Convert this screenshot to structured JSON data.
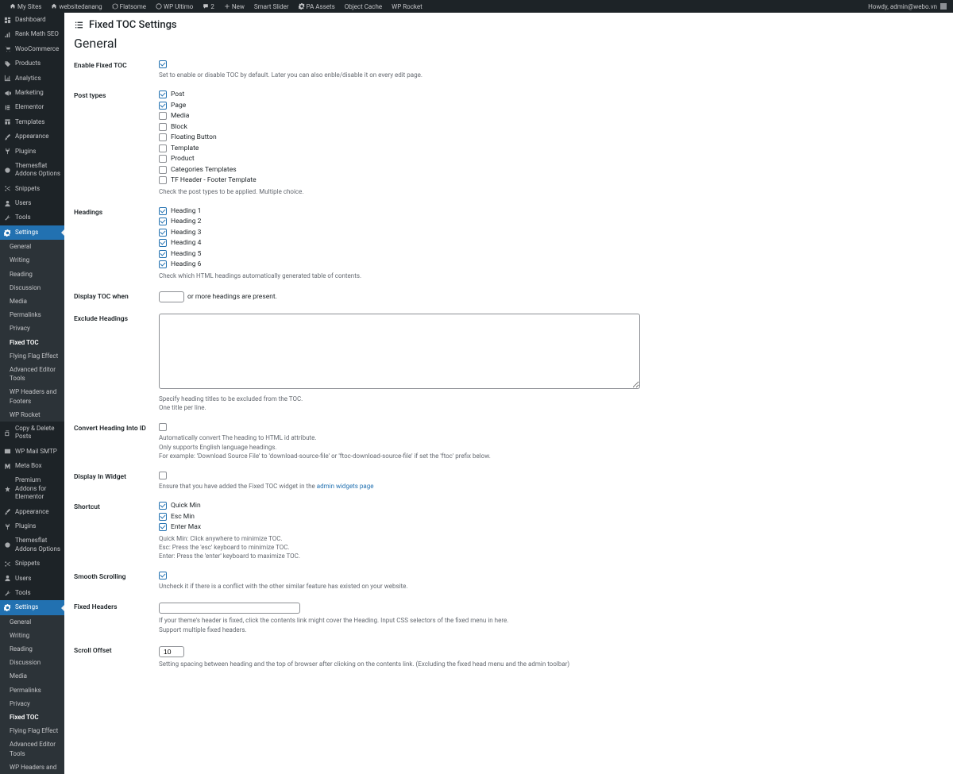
{
  "topbar": {
    "left": [
      {
        "icon": "home",
        "label": "My Sites"
      },
      {
        "icon": "home",
        "label": "websitedanang"
      },
      {
        "icon": "refresh",
        "label": "Flatsome"
      },
      {
        "icon": "wp",
        "label": "WP Ultimo"
      },
      {
        "icon": "comment",
        "label": "2"
      },
      {
        "icon": "plus",
        "label": "New"
      },
      {
        "icon": "",
        "label": "Smart Slider"
      },
      {
        "icon": "gear",
        "label": "PA Assets"
      },
      {
        "icon": "",
        "label": "Object Cache"
      },
      {
        "icon": "",
        "label": "WP Rocket"
      }
    ],
    "howdy": "Howdy, admin@webo.vn"
  },
  "sidebar": {
    "top": [
      {
        "icon": "dashboard",
        "label": "Dashboard"
      },
      {
        "icon": "rank",
        "label": "Rank Math SEO"
      },
      {
        "icon": "cart",
        "label": "WooCommerce"
      },
      {
        "icon": "tag",
        "label": "Products"
      },
      {
        "icon": "chart",
        "label": "Analytics"
      },
      {
        "icon": "megaphone",
        "label": "Marketing"
      },
      {
        "icon": "elementor",
        "label": "Elementor"
      },
      {
        "icon": "templates",
        "label": "Templates"
      },
      {
        "icon": "brush",
        "label": "Appearance"
      },
      {
        "icon": "plug",
        "label": "Plugins"
      },
      {
        "icon": "themesflat",
        "label": "Themesflat Addons Options"
      },
      {
        "icon": "scissors",
        "label": "Snippets"
      },
      {
        "icon": "user",
        "label": "Users"
      },
      {
        "icon": "wrench",
        "label": "Tools"
      }
    ],
    "settings_label": "Settings",
    "settings_sub": [
      {
        "label": "General"
      },
      {
        "label": "Writing"
      },
      {
        "label": "Reading"
      },
      {
        "label": "Discussion"
      },
      {
        "label": "Media"
      },
      {
        "label": "Permalinks"
      },
      {
        "label": "Privacy"
      },
      {
        "label": "Fixed TOC",
        "active": true
      },
      {
        "label": "Flying Flag Effect"
      },
      {
        "label": "Advanced Editor Tools"
      },
      {
        "label": "WP Headers and Footers"
      },
      {
        "label": "WP Rocket"
      }
    ],
    "bottom": [
      {
        "icon": "copy",
        "label": "Copy & Delete Posts"
      },
      {
        "icon": "mail",
        "label": "WP Mail SMTP"
      },
      {
        "icon": "m",
        "label": "Meta Box"
      },
      {
        "icon": "premium",
        "label": "Premium Addons for Elementor"
      },
      {
        "icon": "brush",
        "label": "Appearance"
      },
      {
        "icon": "plug",
        "label": "Plugins"
      },
      {
        "icon": "themesflat",
        "label": "Themesflat Addons Options"
      },
      {
        "icon": "scissors",
        "label": "Snippets"
      },
      {
        "icon": "user",
        "label": "Users"
      },
      {
        "icon": "wrench",
        "label": "Tools"
      }
    ],
    "settings2_label": "Settings",
    "settings2_sub": [
      {
        "label": "General"
      },
      {
        "label": "Writing"
      },
      {
        "label": "Reading"
      },
      {
        "label": "Discussion"
      },
      {
        "label": "Media"
      },
      {
        "label": "Permalinks"
      },
      {
        "label": "Privacy"
      },
      {
        "label": "Fixed TOC",
        "active": true
      },
      {
        "label": "Flying Flag Effect"
      },
      {
        "label": "Advanced Editor Tools"
      },
      {
        "label": "WP Headers and"
      }
    ]
  },
  "main": {
    "page_title": "Fixed TOC Settings",
    "section": "General",
    "enable_label": "Enable Fixed TOC",
    "enable_desc": "Set to enable or disable TOC by default. Later you can also enble/disable it on every edit page.",
    "posttypes_label": "Post types",
    "posttypes": [
      {
        "label": "Post",
        "checked": true
      },
      {
        "label": "Page",
        "checked": true
      },
      {
        "label": "Media",
        "checked": false
      },
      {
        "label": "Block",
        "checked": false
      },
      {
        "label": "Floating Button",
        "checked": false
      },
      {
        "label": "Template",
        "checked": false
      },
      {
        "label": "Product",
        "checked": false
      },
      {
        "label": "Categories Templates",
        "checked": false
      },
      {
        "label": "TF Header - Footer Template",
        "checked": false
      }
    ],
    "posttypes_desc": "Check the post types to be applied. Multiple choice.",
    "headings_label": "Headings",
    "headings": [
      {
        "label": "Heading 1",
        "checked": true
      },
      {
        "label": "Heading 2",
        "checked": true
      },
      {
        "label": "Heading 3",
        "checked": true
      },
      {
        "label": "Heading 4",
        "checked": true
      },
      {
        "label": "Heading 5",
        "checked": true
      },
      {
        "label": "Heading 6",
        "checked": true
      }
    ],
    "headings_desc": "Check which HTML headings automatically generated table of contents.",
    "display_when_label": "Display TOC when",
    "display_when_suffix": "or more headings are present.",
    "exclude_label": "Exclude Headings",
    "exclude_desc1": "Specify heading titles to be excluded from the TOC.",
    "exclude_desc2": "One title per line.",
    "convert_label": "Convert Heading Into ID",
    "convert_desc1": "Automatically convert The heading to HTML id attribute.",
    "convert_desc2": "Only supports English language headings.",
    "convert_desc3": "For example: 'Download Source File' to 'download-source-file' or 'ftoc-download-source-file' if set the 'ftoc' prefix below.",
    "widget_label": "Display In Widget",
    "widget_desc": "Ensure that you have added the Fixed TOC widget in the ",
    "widget_link": "admin widgets page",
    "shortcut_label": "Shortcut",
    "shortcuts": [
      {
        "label": "Quick Min",
        "checked": true
      },
      {
        "label": "Esc Min",
        "checked": true
      },
      {
        "label": "Enter Max",
        "checked": true
      }
    ],
    "shortcut_desc1": "Quick Min: Click anywhere to minimize TOC.",
    "shortcut_desc2": "Esc: Press the 'esc' keyboard to minimize TOC.",
    "shortcut_desc3": "Enter: Press the 'enter' keyboard to maximize TOC.",
    "smooth_label": "Smooth Scrolling",
    "smooth_desc": "Uncheck it if there is a conflict with the other similar feature has existed on your website.",
    "fixedheaders_label": "Fixed Headers",
    "fixedheaders_desc1": "If your theme's header is fixed, click the contents link might cover the Heading. Input CSS selectors of the fixed menu in here.",
    "fixedheaders_desc2": "Support multiple fixed headers.",
    "scrolloffset_label": "Scroll Offset",
    "scrolloffset_value": "10",
    "scrolloffset_desc": "Setting spacing between heading and the top of browser after clicking on the contents link. (Excluding the fixed head menu and the admin toolbar)"
  }
}
